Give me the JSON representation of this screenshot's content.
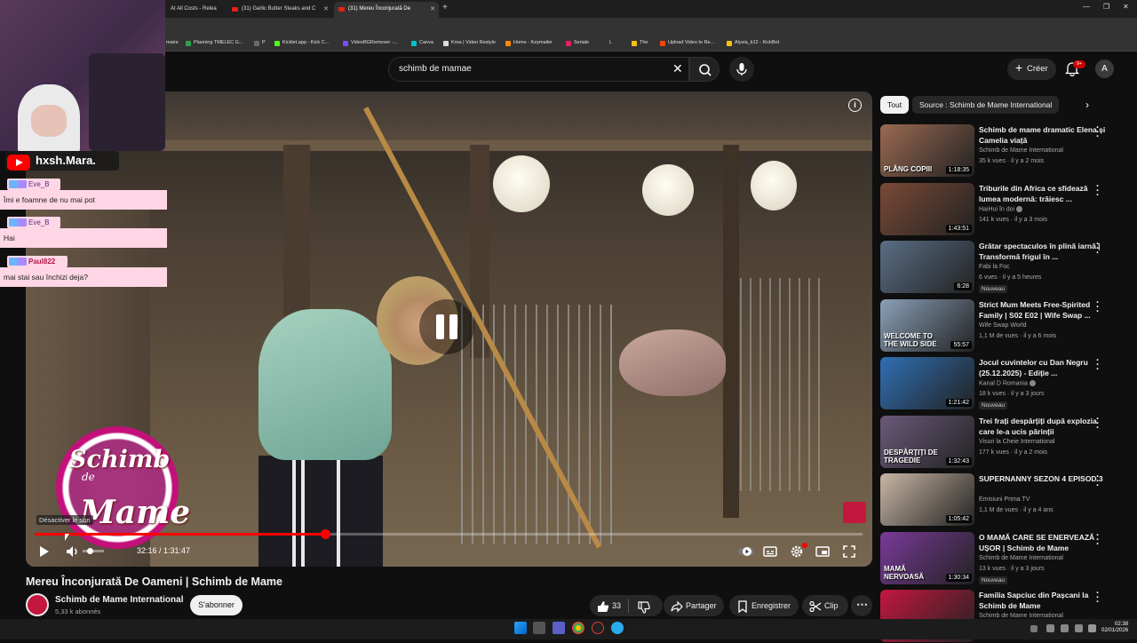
{
  "browser": {
    "tabs": [
      {
        "label": "At All Costs - Relea"
      },
      {
        "label": "(31) Garlic Butter Steaks and C"
      },
      {
        "label": "(31) Mereu Înconjurată De"
      }
    ],
    "bookmarks": [
      "maire",
      "Planning TMELEC G...",
      "P",
      "Kicklet.app - Kick C...",
      "VideoBGRemover -...",
      "Canva",
      "Krea | Video Restyle",
      "Home - Keymailer",
      "Seriale",
      "L",
      "The",
      "Upload Video to Re...",
      "Alysia_k12 - KickBot"
    ]
  },
  "header": {
    "search_value": "schimb de mamae",
    "create_label": "Créer",
    "notification_count": "9+",
    "avatar_letter": "A"
  },
  "player": {
    "current_time": "32:16",
    "duration": "1:31:47",
    "time_display": "32:16 / 1:31:47",
    "progress_fraction": 0.351,
    "tooltip": "Désactiver le son",
    "logo_line1": "Schimb",
    "logo_line2": "de",
    "logo_line3": "Mame"
  },
  "video": {
    "title": "Mereu Înconjurată De Oameni | Schimb de Mame",
    "channel": "Schimb de Mame International",
    "subscribers": "5,33 k abonnés",
    "subscribe_label": "S'abonner",
    "likes": "33",
    "share_label": "Partager",
    "save_label": "Enregistrer",
    "clip_label": "Clip"
  },
  "sidebar": {
    "chips": [
      "Tout",
      "Source : Schimb de Mame International"
    ],
    "recommendations": [
      {
        "title": "Schimb de mame dramatic Elena și Camelia viață",
        "channel": "Schimb de Mame International",
        "meta": "35 k vues · il y a 2 mois",
        "duration": "1:18:35",
        "badge": "",
        "verified": false,
        "color": "#9b6a52"
      },
      {
        "title": "Triburile din Africa ce sfidează lumea modernă: trăiesc ...",
        "channel": "HaiHui în doi",
        "meta": "141 k vues · il y a 3 mois",
        "duration": "1:43:51",
        "badge": "",
        "verified": true,
        "color": "#7a4a36"
      },
      {
        "title": "Grătar spectaculos în plină iarnă | Transformă frigul în ...",
        "channel": "Fabi la Foc",
        "meta": "6 vues · il y a 5 heures",
        "duration": "6:28",
        "badge": "Nouveau",
        "verified": false,
        "color": "#5a6e86"
      },
      {
        "title": "Strict Mum Meets Free-Spirited Family | S02 E02 | Wife Swap ...",
        "channel": "Wife Swap World",
        "meta": "1,1 M de vues · il y a 6 mois",
        "duration": "55:57",
        "badge": "",
        "verified": false,
        "color": "#8aa0b8"
      },
      {
        "title": "Jocul cuvintelor cu Dan Negru (25.12.2025) - Ediție ...",
        "channel": "Kanal D Romania",
        "meta": "18 k vues · il y a 3 jours",
        "duration": "1:21:42",
        "badge": "Nouveau",
        "verified": true,
        "color": "#2f6fb3"
      },
      {
        "title": "Trei frați despărțiți după explozia care le-a ucis părinții",
        "channel": "Visuri la Cheie International",
        "meta": "177 k vues · il y a 2 mois",
        "duration": "1:32:43",
        "badge": "",
        "verified": false,
        "color": "#6a5a7a"
      },
      {
        "title": "SUPERNANNY SEZON 4 EPISOD 3",
        "channel": "Emisiuni Prima TV",
        "meta": "1,1 M de vues · il y a 4 ans",
        "duration": "1:05:42",
        "badge": "",
        "verified": false,
        "color": "#c9b7a5"
      },
      {
        "title": "O MAMĂ CARE SE ENERVEAZĂ UȘOR | Schimb de Mame",
        "channel": "Schimb de Mame International",
        "meta": "13 k vues · il y a 3 jours",
        "duration": "1:30:34",
        "badge": "Nouveau",
        "verified": false,
        "color": "#7a3a9a"
      },
      {
        "title": "Familia Sapciuc din Pașcani la Schimb de Mame",
        "channel": "Schimb de Mame International",
        "meta": "",
        "duration": "",
        "badge": "",
        "verified": false,
        "color": "#c4173e"
      }
    ],
    "thumb_texts": [
      "PLÂNG COPIII",
      "DESPĂRȚIȚI DE TRAGEDIE",
      "MAMĂ NERVOASĂ",
      "WELCOME TO THE WILD SIDE"
    ]
  },
  "overlay": {
    "streamer": "hxsh.Mara.",
    "chat": [
      {
        "user": "Eve_B",
        "message": "Îmi e foamne de nu mai pot"
      },
      {
        "user": "Eve_B",
        "message": "Hai"
      },
      {
        "user": "Paul822",
        "message": "mai stai sau închizi deja?"
      }
    ]
  },
  "taskbar": {
    "time": "02:38",
    "date": "02/01/2026"
  },
  "colors": {
    "accent": "#ff0000",
    "background": "#0f0f0f",
    "chat_bubble": "#ffd6e5"
  }
}
